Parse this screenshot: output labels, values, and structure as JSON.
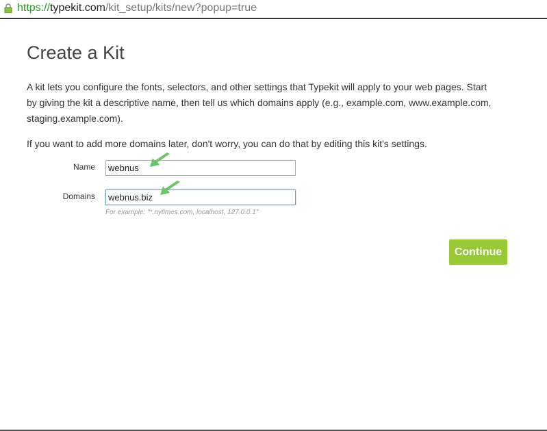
{
  "browser": {
    "url_scheme": "https://",
    "url_host": "typekit.com",
    "url_path": "/kit_setup/kits/new?popup=true"
  },
  "page": {
    "title": "Create a Kit",
    "intro": "A kit lets you configure the fonts, selectors, and other settings that Typekit will apply to your web pages. Start by giving the kit a descriptive name, then tell us which domains apply (e.g., example.com, www.example.com, staging.example.com).",
    "note": "If you want to add more domains later, don't worry, you can do that by editing this kit's settings."
  },
  "form": {
    "name_label": "Name",
    "name_value": "webnus",
    "domains_label": "Domains",
    "domains_value": "webnus.biz",
    "domains_hint": "For example: \"*.nytimes.com, localhost, 127.0.0.1\"",
    "continue_label": "Continue"
  },
  "colors": {
    "accent": "#99c936",
    "arrow": "#6cc36a"
  }
}
